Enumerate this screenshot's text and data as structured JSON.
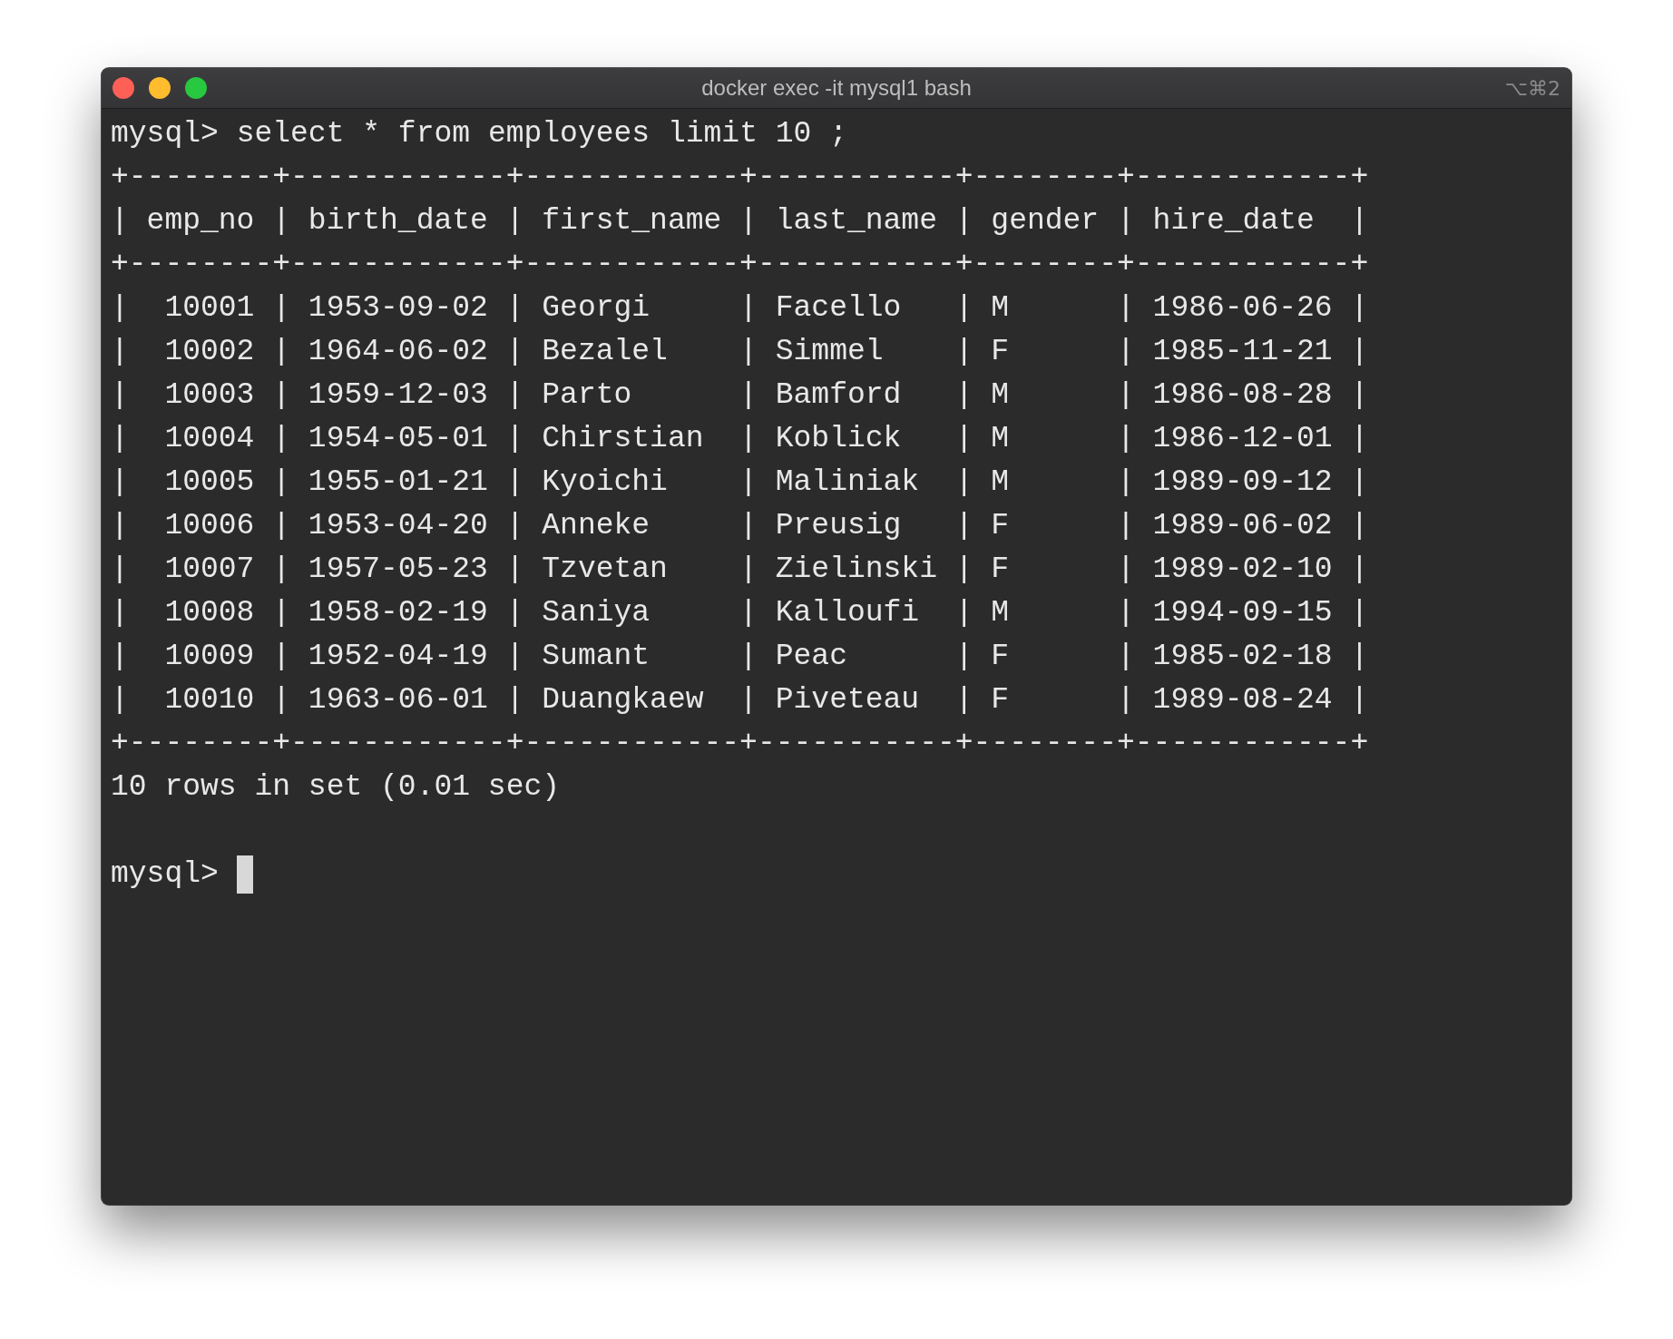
{
  "window": {
    "title": "docker exec -it mysql1 bash",
    "shortcut": "⌥⌘2"
  },
  "command": {
    "prompt": "mysql>",
    "text": "select * from employees limit 10 ;"
  },
  "table_lines": [
    "+--------+------------+------------+-----------+--------+------------+",
    "| emp_no | birth_date | first_name | last_name | gender | hire_date  |",
    "+--------+------------+------------+-----------+--------+------------+",
    "|  10001 | 1953-09-02 | Georgi     | Facello   | M      | 1986-06-26 |",
    "|  10002 | 1964-06-02 | Bezalel    | Simmel    | F      | 1985-11-21 |",
    "|  10003 | 1959-12-03 | Parto      | Bamford   | M      | 1986-08-28 |",
    "|  10004 | 1954-05-01 | Chirstian  | Koblick   | M      | 1986-12-01 |",
    "|  10005 | 1955-01-21 | Kyoichi    | Maliniak  | M      | 1989-09-12 |",
    "|  10006 | 1953-04-20 | Anneke     | Preusig   | F      | 1989-06-02 |",
    "|  10007 | 1957-05-23 | Tzvetan    | Zielinski | F      | 1989-02-10 |",
    "|  10008 | 1958-02-19 | Saniya     | Kalloufi  | M      | 1994-09-15 |",
    "|  10009 | 1952-04-19 | Sumant     | Peac      | F      | 1985-02-18 |",
    "|  10010 | 1963-06-01 | Duangkaew  | Piveteau  | F      | 1989-08-24 |",
    "+--------+------------+------------+-----------+--------+------------+"
  ],
  "result": "10 rows in set (0.01 sec)",
  "next_prompt": "mysql>"
}
